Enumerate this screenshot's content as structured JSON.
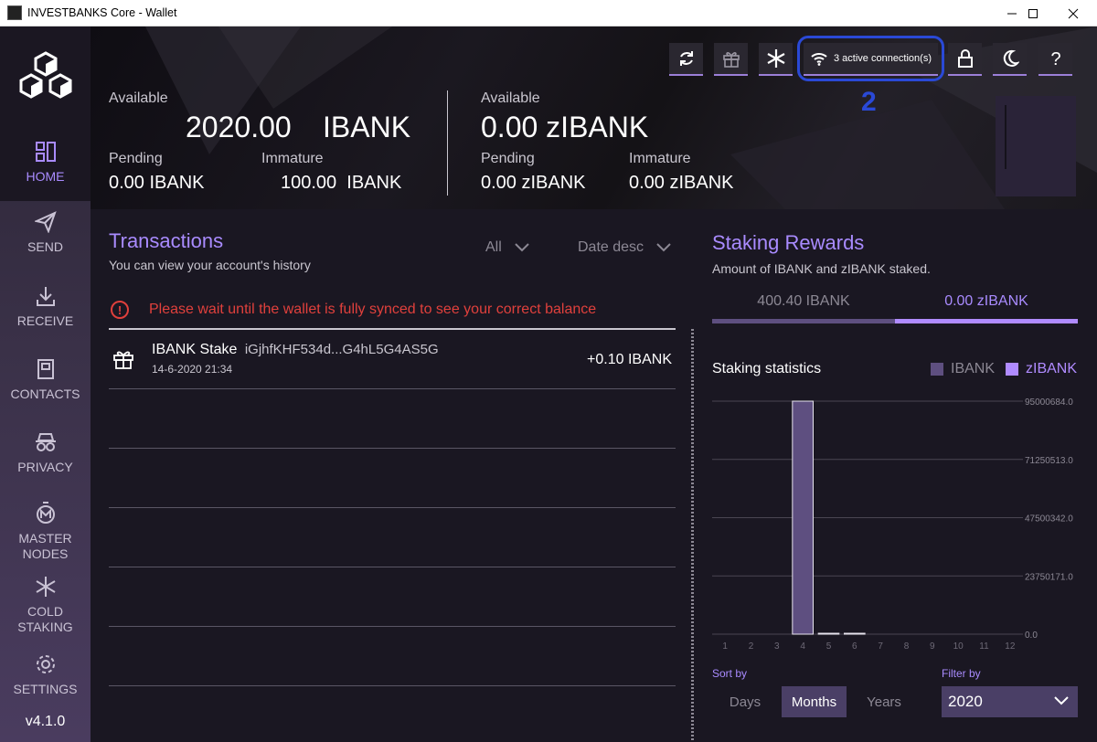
{
  "window": {
    "title": "INVESTBANKS Core - Wallet"
  },
  "sidebar": {
    "items": [
      {
        "label": "HOME",
        "icon": "home-icon",
        "active": true
      },
      {
        "label": "SEND",
        "icon": "send-icon"
      },
      {
        "label": "RECEIVE",
        "icon": "receive-icon"
      },
      {
        "label": "CONTACTS",
        "icon": "contacts-icon"
      },
      {
        "label": "PRIVACY",
        "icon": "privacy-icon"
      },
      {
        "label": "MASTER\nNODES",
        "icon": "masternodes-icon"
      },
      {
        "label": "COLD\nSTAKING",
        "icon": "cold-staking-icon"
      },
      {
        "label": "SETTINGS",
        "icon": "settings-icon"
      }
    ],
    "version": "v4.1.0"
  },
  "header": {
    "ibank": {
      "available_label": "Available",
      "available_value": "2020.00",
      "available_unit": "IBANK",
      "pending_label": "Pending",
      "pending_value": "0.00 IBANK",
      "immature_label": "Immature",
      "immature_value": "100.00  IBANK"
    },
    "zibank": {
      "available_label": "Available",
      "available_value": "0.00 zIBANK",
      "pending_label": "Pending",
      "pending_value": "0.00 zIBANK",
      "immature_label": "Immature",
      "immature_value": "0.00 zIBANK"
    },
    "toolbar": {
      "connections": "3 active connection(s)"
    },
    "annotation": "2"
  },
  "transactions": {
    "title": "Transactions",
    "subtitle": "You can view your account's history",
    "filter_type": "All",
    "sort": "Date desc",
    "warning": "Please wait until the wallet is fully synced to see your correct balance",
    "rows": [
      {
        "type": "IBANK Stake",
        "address": "iGjhfKHF534d...G4hL5G4AS5G",
        "date": "14-6-2020 21:34",
        "amount": "+0.10 IBANK"
      }
    ]
  },
  "staking": {
    "title": "Staking Rewards",
    "subtitle": "Amount of IBANK and zIBANK staked.",
    "tab_ibank": "400.40 IBANK",
    "tab_zibank": "0.00 zIBANK",
    "stats_title": "Staking statistics",
    "legend_ibank": "IBANK",
    "legend_zibank": "zIBANK",
    "sort_by_label": "Sort by",
    "filter_by_label": "Filter by",
    "sort_options": [
      "Days",
      "Months",
      "Years"
    ],
    "sort_selected": "Months",
    "filter_value": "2020"
  },
  "colors": {
    "accent": "#a98bff",
    "ibank_bar": "#5e4f80",
    "zibank_bar": "#b08bff",
    "warning": "#e0403c"
  },
  "chart_data": {
    "type": "bar",
    "categories": [
      "1",
      "2",
      "3",
      "4",
      "5",
      "6",
      "7",
      "8",
      "9",
      "10",
      "11",
      "12"
    ],
    "series": [
      {
        "name": "IBANK",
        "values": [
          0,
          0,
          0,
          95000684.0,
          180000,
          120000,
          0,
          0,
          0,
          0,
          0,
          0
        ]
      },
      {
        "name": "zIBANK",
        "values": [
          0,
          0,
          0,
          0,
          0,
          0,
          0,
          0,
          0,
          0,
          0,
          0
        ]
      }
    ],
    "y_ticks": [
      "95000684.0",
      "71250513.0",
      "47500342.0",
      "23750171.0",
      "0.0"
    ],
    "ylim": [
      0,
      95000684.0
    ],
    "grid": true,
    "legend": "top-right"
  }
}
